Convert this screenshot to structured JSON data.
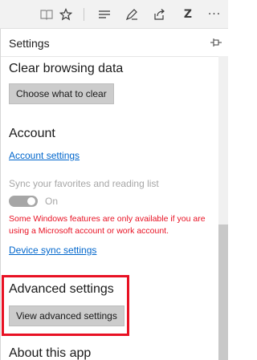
{
  "toolbar": {
    "icons": [
      "reading-view-icon",
      "favorite-star-icon",
      "hub-icon",
      "web-note-icon",
      "share-icon",
      "z-extension-icon",
      "more-icon"
    ],
    "z_label": "Z",
    "more_label": "···"
  },
  "panel": {
    "title": "Settings"
  },
  "clear_browsing": {
    "title": "Clear browsing data",
    "button": "Choose what to clear"
  },
  "account": {
    "title": "Account",
    "settings_link": "Account settings",
    "sync_label": "Sync your favorites and reading list",
    "toggle_state": "On",
    "warning": "Some Windows features are only available if you are using a Microsoft account or work account.",
    "device_sync_link": "Device sync settings"
  },
  "advanced": {
    "title": "Advanced settings",
    "button": "View advanced settings"
  },
  "about": {
    "title": "About this app"
  },
  "colors": {
    "accent": "#0066cc",
    "warning": "#e81123",
    "highlight": "#e81123"
  }
}
